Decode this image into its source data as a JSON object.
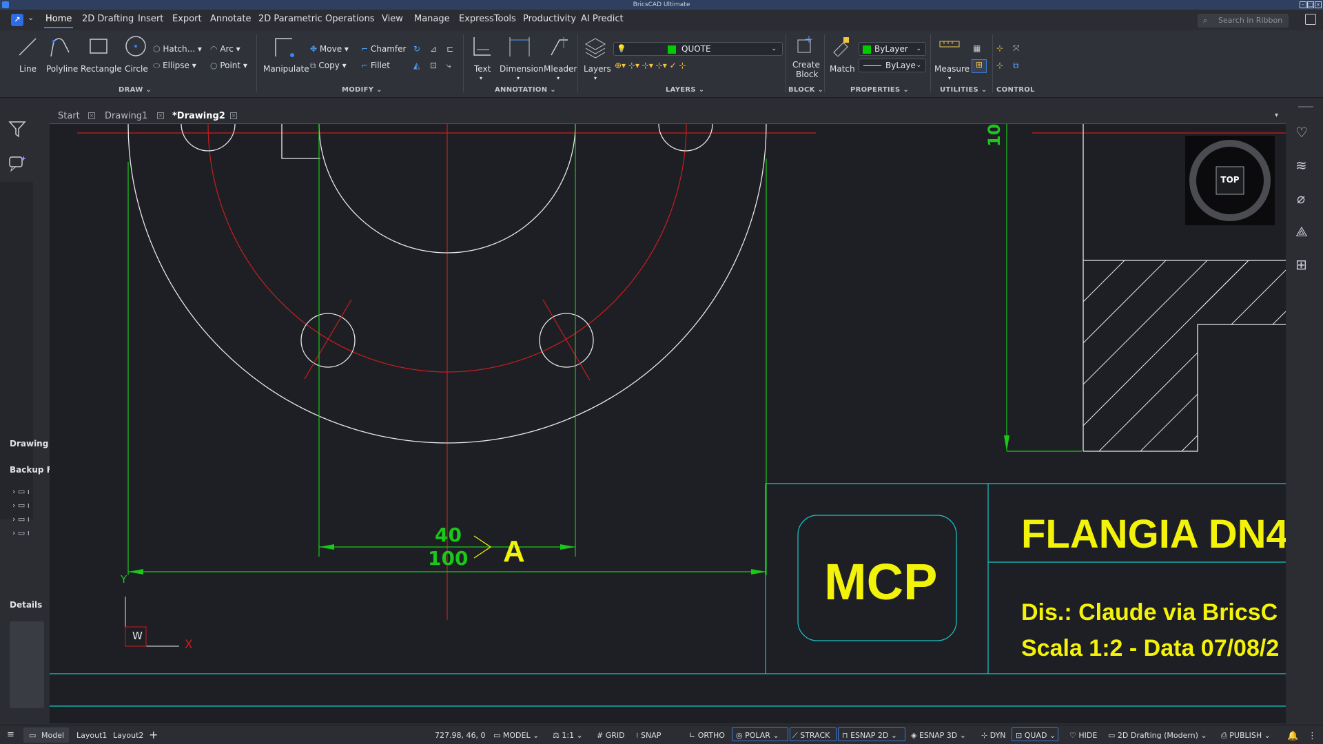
{
  "window": {
    "title": "BricsCAD Ultimate"
  },
  "menu": {
    "tabs": [
      "Home",
      "2D Drafting",
      "Insert",
      "Export",
      "Annotate",
      "2D Parametric",
      "Operations",
      "View",
      "Manage",
      "ExpressTools",
      "Productivity",
      "AI Predict"
    ],
    "search_placeholder": "Search in Ribbon"
  },
  "ribbon": {
    "draw": {
      "line": "Line",
      "polyline": "Polyline",
      "rectangle": "Rectangle",
      "circle": "Circle",
      "hatch": "Hatch...",
      "ellipse": "Ellipse",
      "arc": "Arc",
      "point": "Point",
      "group": "DRAW"
    },
    "modify": {
      "manipulate": "Manipulate",
      "move": "Move",
      "copy": "Copy",
      "chamfer": "Chamfer",
      "fillet": "Fillet",
      "group": "MODIFY"
    },
    "annotation": {
      "text": "Text",
      "dimension": "Dimension",
      "mleader": "Mleader",
      "group": "ANNOTATION"
    },
    "layers": {
      "layers": "Layers",
      "current_layer": "QUOTE",
      "group": "LAYERS"
    },
    "block": {
      "create_block_1": "Create",
      "create_block_2": "Block",
      "group": "BLOCK"
    },
    "properties": {
      "match": "Match",
      "color": "ByLayer",
      "linetype": "ByLaye",
      "group": "PROPERTIES"
    },
    "utilities": {
      "measure": "Measure",
      "group": "UTILITIES"
    },
    "control": {
      "group": "CONTROL"
    }
  },
  "colors": {
    "layer_swatch": "#00cc00",
    "color_swatch": "#00cc00",
    "accent": "#3b82f6",
    "canvas": "#1e1f24"
  },
  "left_panel": {
    "drawing": "Drawing",
    "backup": "Backup F",
    "details": "Details"
  },
  "doc_tabs": [
    "Start",
    "Drawing1",
    "*Drawing2"
  ],
  "drawing": {
    "dim_10": "10",
    "dim_40": "40",
    "dim_100": "100",
    "section_label": "A",
    "logo_text": "MCP",
    "title_text": "FLANGIA DN4",
    "author_text": "Dis.: Claude via BricsC",
    "scale_text": "Scala 1:2 - Data 07/08/2",
    "ucs_w": "W",
    "ucs_x": "X",
    "ucs_y": "Y",
    "viewcube": "TOP"
  },
  "status": {
    "tabs": [
      "Model",
      "Layout1",
      "Layout2"
    ],
    "coords": "727.98, 46, 0",
    "model": "MODEL",
    "scale": "1:1",
    "grid": "GRID",
    "snap": "SNAP",
    "ortho": "ORTHO",
    "polar": "POLAR",
    "strack": "STRACK",
    "esnap2d": "ESNAP 2D",
    "esnap3d": "ESNAP 3D",
    "dyn": "DYN",
    "quad": "QUAD",
    "hide": "HIDE",
    "workspace": "2D Drafting (Modern)",
    "publish": "PUBLISH"
  }
}
